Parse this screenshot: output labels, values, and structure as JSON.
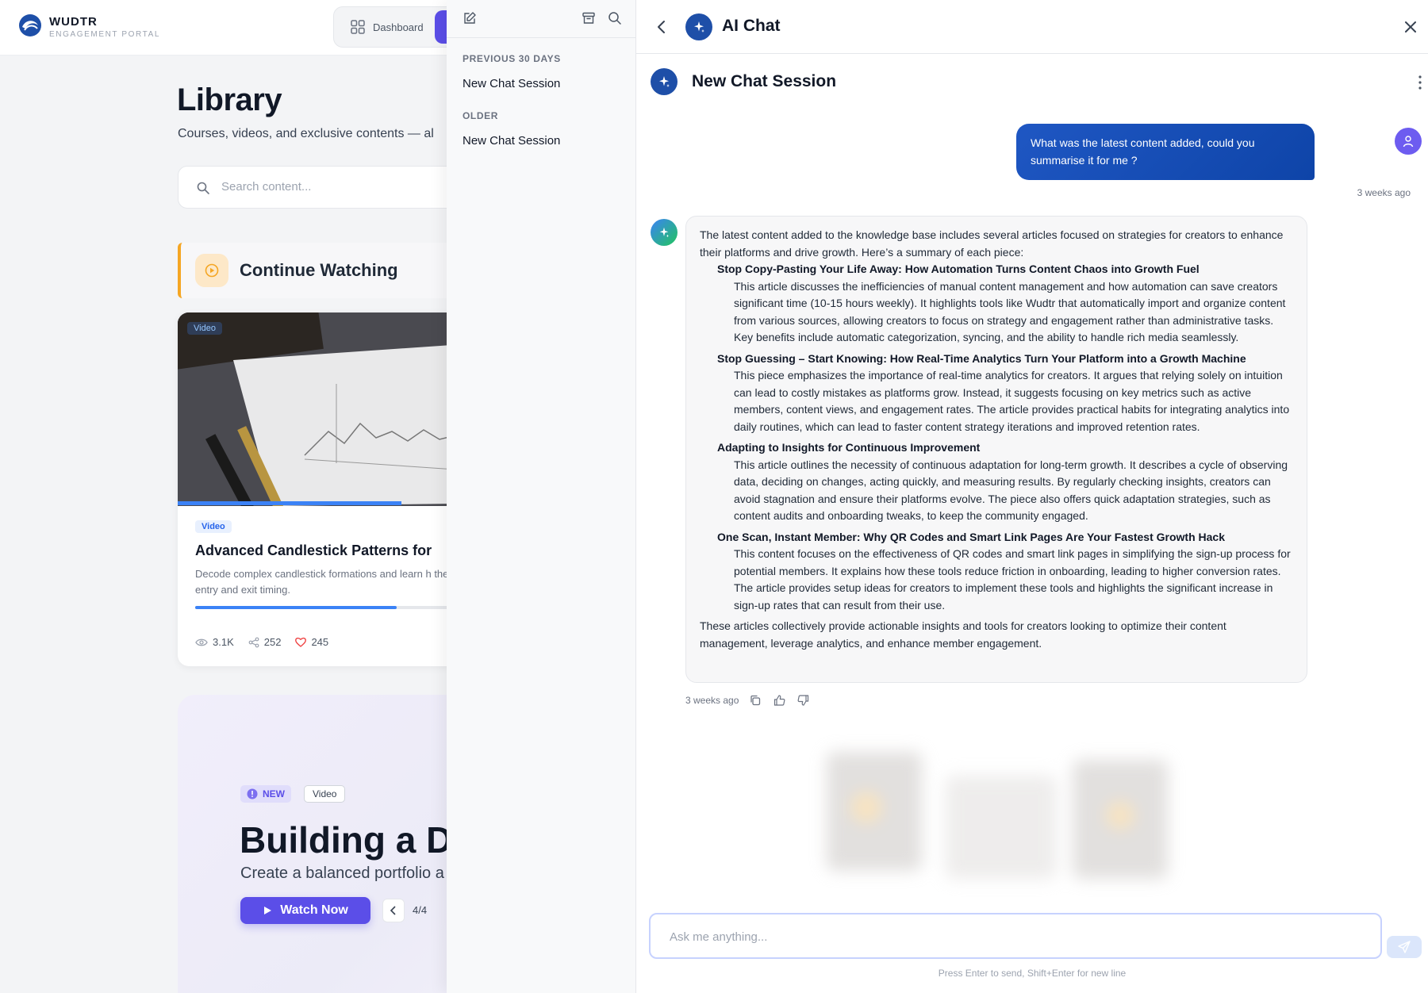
{
  "brand": {
    "name": "WUDTR",
    "subtitle": "ENGAGEMENT PORTAL"
  },
  "topnav": {
    "dashboard_label": "Dashboard"
  },
  "library": {
    "title": "Library",
    "subtitle": "Courses, videos, and exclusive contents — al",
    "search_placeholder": "Search content..."
  },
  "continue_watching": {
    "title": "Continue Watching",
    "card": {
      "image_badge": "Video",
      "badge": "Video",
      "title": "Advanced Candlestick Patterns for",
      "description": "Decode complex candlestick formations and learn h them for precise entry and exit timing.",
      "progress": 0.67,
      "views": "3.1K",
      "shares": "252",
      "likes": "245"
    }
  },
  "hero": {
    "new_label": "NEW",
    "type_label": "Video",
    "title": "Building a Di",
    "subtitle": "Create a balanced portfolio a",
    "watch_label": "Watch Now",
    "page_indicator": "4/4"
  },
  "sessions": {
    "groups": [
      {
        "heading": "PREVIOUS 30 DAYS",
        "items": [
          "New Chat Session"
        ]
      },
      {
        "heading": "OLDER",
        "items": [
          "New Chat Session"
        ]
      }
    ]
  },
  "chat": {
    "title": "AI Chat",
    "session_title": "New Chat Session",
    "user_message": "What was the latest content added, could you summarise it for me ?",
    "user_time": "3 weeks ago",
    "ai_intro": "The latest content added to the knowledge base includes several articles focused on strategies for creators to enhance their platforms and drive growth. Here’s a summary of each piece:",
    "ai_items": [
      {
        "title": "Stop Copy-Pasting Your Life Away: How Automation Turns Content Chaos into Growth Fuel",
        "body": "This article discusses the inefficiencies of manual content management and how automation can save creators significant time (10-15 hours weekly). It highlights tools like Wudtr that automatically import and organize content from various sources, allowing creators to focus on strategy and engagement rather than administrative tasks. Key benefits include automatic categorization, syncing, and the ability to handle rich media seamlessly."
      },
      {
        "title": "Stop Guessing – Start Knowing: How Real-Time Analytics Turn Your Platform into a Growth Machine",
        "body": "This piece emphasizes the importance of real-time analytics for creators. It argues that relying solely on intuition can lead to costly mistakes as platforms grow. Instead, it suggests focusing on key metrics such as active members, content views, and engagement rates. The article provides practical habits for integrating analytics into daily routines, which can lead to faster content strategy iterations and improved retention rates."
      },
      {
        "title": "Adapting to Insights for Continuous Improvement",
        "body": "This article outlines the necessity of continuous adaptation for long-term growth. It describes a cycle of observing data, deciding on changes, acting quickly, and measuring results. By regularly checking insights, creators can avoid stagnation and ensure their platforms evolve. The piece also offers quick adaptation strategies, such as content audits and onboarding tweaks, to keep the community engaged."
      },
      {
        "title": "One Scan, Instant Member: Why QR Codes and Smart Link Pages Are Your Fastest Growth Hack",
        "body": "This content focuses on the effectiveness of QR codes and smart link pages in simplifying the sign-up process for potential members. It explains how these tools reduce friction in onboarding, leading to higher conversion rates. The article provides setup ideas for creators to implement these tools and highlights the significant increase in sign-up rates that can result from their use."
      }
    ],
    "ai_outro": "These articles collectively provide actionable insights and tools for creators looking to optimize their content management, leverage analytics, and enhance member engagement.",
    "ai_time": "3 weeks ago",
    "input_placeholder": "Ask me anything...",
    "hint": "Press Enter to send, Shift+Enter for new line"
  },
  "colors": {
    "accent": "#5b4ee8",
    "chat_primary": "#1e4fa8",
    "progress": "#3b82f6",
    "continue_watching_accent": "#f5a623"
  }
}
